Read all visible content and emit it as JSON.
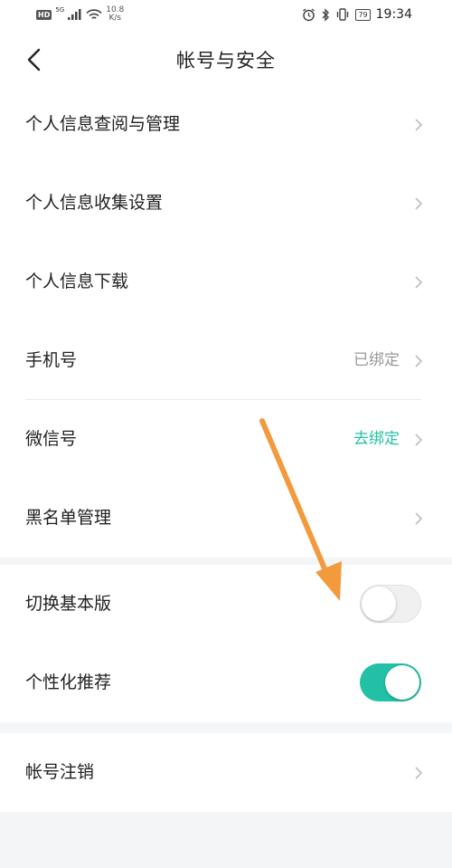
{
  "status_bar": {
    "hd": "HD",
    "signal_5g": "5G",
    "net_speed_value": "10.8",
    "net_speed_unit": "K/s",
    "battery": "79",
    "time": "19:34"
  },
  "header": {
    "title": "帐号与安全"
  },
  "group1": {
    "items": [
      {
        "label": "个人信息查阅与管理"
      },
      {
        "label": "个人信息收集设置"
      },
      {
        "label": "个人信息下载"
      },
      {
        "label": "手机号",
        "value": "已绑定"
      },
      {
        "label": "微信号",
        "value": "去绑定"
      },
      {
        "label": "黑名单管理"
      }
    ]
  },
  "group2": {
    "items": [
      {
        "label": "切换基本版",
        "toggle": false
      },
      {
        "label": "个性化推荐",
        "toggle": true
      }
    ]
  },
  "group3": {
    "items": [
      {
        "label": "帐号注销"
      }
    ]
  },
  "colors": {
    "accent": "#22c1a5",
    "annotation_arrow": "#f39a3d"
  }
}
